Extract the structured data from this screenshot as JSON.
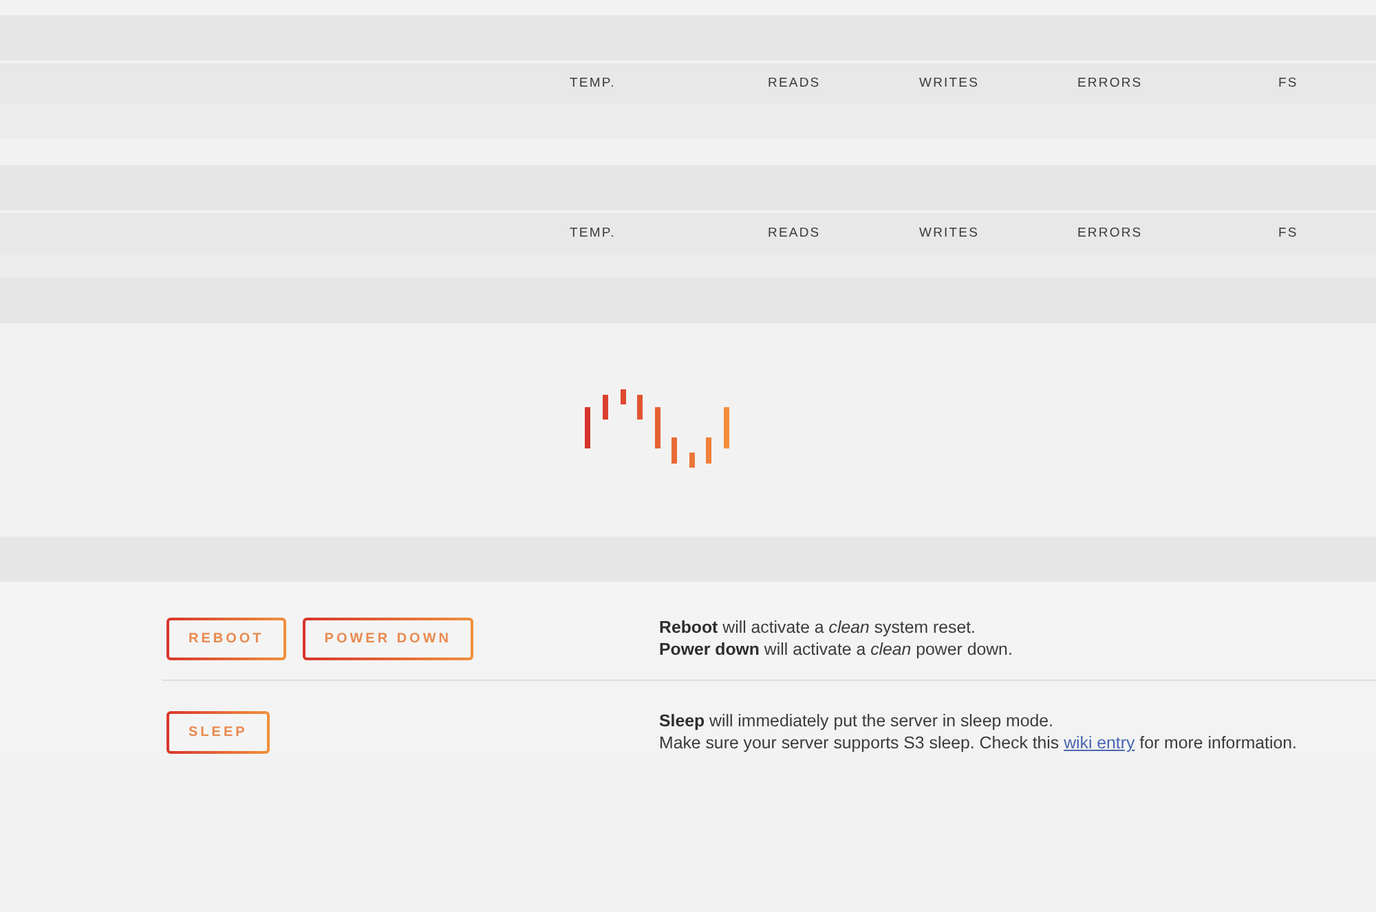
{
  "panels": [
    {
      "kind": "table",
      "columns": [
        "TEMP.",
        "READS",
        "WRITES",
        "ERRORS",
        "FS"
      ]
    },
    {
      "kind": "table",
      "columns": [
        "TEMP.",
        "READS",
        "WRITES",
        "ERRORS",
        "FS"
      ]
    },
    {
      "kind": "loading"
    },
    {
      "kind": "actions",
      "rows": [
        {
          "buttons": [
            "REBOOT",
            "POWER DOWN"
          ],
          "lines": [
            {
              "text": "**Reboot** will activate a *clean* system reset."
            },
            {
              "text": "**Power down** will activate a *clean* power down."
            }
          ]
        },
        {
          "buttons": [
            "SLEEP"
          ],
          "lines": [
            {
              "text": "**Sleep** will immediately put the server in sleep mode."
            },
            {
              "text": "Make sure your server supports S3 sleep. Check this ",
              "link": "wiki entry",
              "after": " for more information."
            }
          ]
        }
      ]
    }
  ]
}
